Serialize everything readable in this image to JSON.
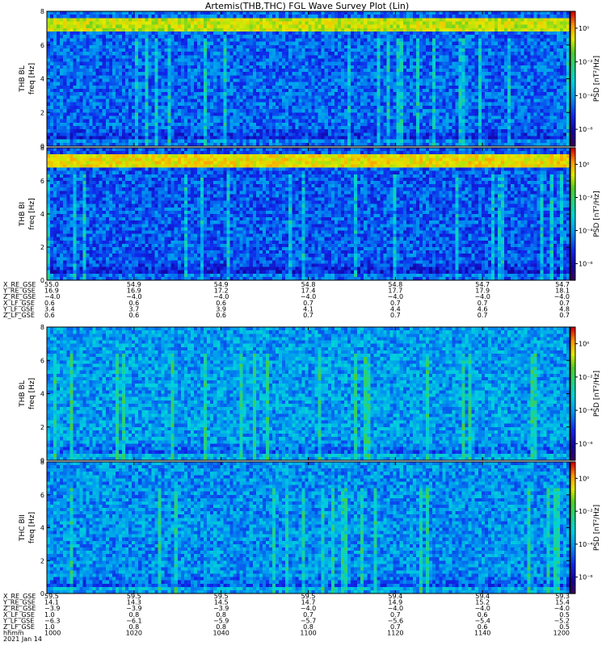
{
  "title": "Artemis(THB,THC) FGL Wave Survey Plot (Lin)",
  "colors": {
    "background": "#ffffff",
    "frame": "#000000"
  },
  "chart_data": {
    "type": "heatmap",
    "title": "Artemis(THB,THC) FGL Wave Survey Plot (Lin)",
    "xlabel": "hhmm",
    "date_label": "2021 Jan 14",
    "x_ticks": [
      "1000",
      "1020",
      "1040",
      "1100",
      "1120",
      "1140",
      "1200"
    ],
    "colormap": "rainbow (purple-blue-cyan-green-yellow-red)",
    "panels": [
      {
        "id": "thb-bl",
        "ylabel_top": "THB BL",
        "ylabel_bottom": "freq [Hz]",
        "yticks": [
          "0",
          "2",
          "4",
          "6",
          "8"
        ],
        "ylim": [
          0,
          8
        ],
        "zlabel": "PSD [nT²/Hz]",
        "zticks": [
          "10⁰",
          "10⁻²",
          "10⁻⁴",
          "10⁻⁶"
        ],
        "zlim_exp": [
          -7,
          1
        ],
        "group": "THB",
        "features": {
          "line_band_hz": [
            6.9,
            7.6
          ],
          "line_level": 0.78,
          "base_level": 0.3
        }
      },
      {
        "id": "thb-bi",
        "ylabel_top": "THB BI",
        "ylabel_bottom": "freq [Hz]",
        "yticks": [
          "0",
          "2",
          "4",
          "6",
          "8"
        ],
        "ylim": [
          0,
          8
        ],
        "zlabel": "PSD [nT²/Hz]",
        "zticks": [
          "10⁰",
          "10⁻²",
          "10⁻⁴",
          "10⁻⁶"
        ],
        "zlim_exp": [
          -7,
          1
        ],
        "group": "THB",
        "features": {
          "line_band_hz": [
            6.9,
            7.6
          ],
          "line_level": 0.82,
          "base_level": 0.28
        }
      },
      {
        "id": "thb-bl-2",
        "ylabel_top": "THB BL",
        "ylabel_bottom": "freq [Hz]",
        "yticks": [
          "0",
          "2",
          "4",
          "6",
          "8"
        ],
        "ylim": [
          0,
          8
        ],
        "zlabel": "PSD [nT²/Hz]",
        "zticks": [
          "10⁰",
          "10⁻²",
          "10⁻⁴",
          "10⁻⁶"
        ],
        "zlim_exp": [
          -7,
          1
        ],
        "group": "THC",
        "features": {
          "line_band_hz": null,
          "line_level": 0,
          "base_level": 0.38
        }
      },
      {
        "id": "thc-bii",
        "ylabel_top": "THC BII",
        "ylabel_bottom": "freq [Hz]",
        "yticks": [
          "0",
          "2",
          "4",
          "6",
          "8"
        ],
        "ylim": [
          0,
          8
        ],
        "zlabel": "PSD [nT²/Hz]",
        "zticks": [
          "10⁰",
          "10⁻²",
          "10⁻⁴",
          "10⁻⁶"
        ],
        "zlim_exp": [
          -7,
          1
        ],
        "group": "THC",
        "features": {
          "line_band_hz": null,
          "line_level": 0,
          "base_level": 0.36
        }
      }
    ],
    "ephemeris": [
      {
        "group": "THB",
        "rows": [
          {
            "label": "X_RE_GSE",
            "values": [
              "55.0",
              "54.9",
              "54.9",
              "54.8",
              "54.8",
              "54.7",
              "54.7"
            ]
          },
          {
            "label": "Y_RE_GSE",
            "values": [
              "16.9",
              "16.9",
              "17.2",
              "17.4",
              "17.7",
              "17.9",
              "18.1"
            ]
          },
          {
            "label": "Z_RE_GSE",
            "values": [
              "−4.0",
              "−4.0",
              "−4.0",
              "−4.0",
              "−4.0",
              "−4.0",
              "−4.0"
            ]
          },
          {
            "label": "X_LF_GSE",
            "values": [
              "0.6",
              "0.6",
              "0.6",
              "0.7",
              "0.7",
              "0.7",
              "0.7"
            ]
          },
          {
            "label": "Y_LF_GSE",
            "values": [
              "3.4",
              "3.7",
              "3.9",
              "4.1",
              "4.4",
              "4.6",
              "4.8"
            ]
          },
          {
            "label": "Z_LF_GSE",
            "values": [
              "0.6",
              "0.6",
              "0.6",
              "0.7",
              "0.7",
              "0.7",
              "0.7"
            ]
          }
        ]
      },
      {
        "group": "THC",
        "rows": [
          {
            "label": "X_RE_GSE",
            "values": [
              "59.5",
              "59.5",
              "59.5",
              "59.5",
              "59.4",
              "59.4",
              "59.3"
            ]
          },
          {
            "label": "Y_RE_GSE",
            "values": [
              "14.1",
              "14.3",
              "14.5",
              "14.7",
              "14.9",
              "15.2",
              "15.4"
            ]
          },
          {
            "label": "Z_RE_GSE",
            "values": [
              "−3.9",
              "−3.9",
              "−3.9",
              "−4.0",
              "−4.0",
              "−4.0",
              "−4.0"
            ]
          },
          {
            "label": "X_LF_GSE",
            "values": [
              "1.0",
              "0.8",
              "0.8",
              "0.7",
              "0.7",
              "0.6",
              "0.5"
            ]
          },
          {
            "label": "Y_LF_GSE",
            "values": [
              "−6.3",
              "−6.1",
              "−5.9",
              "−5.7",
              "−5.6",
              "−5.4",
              "−5.2"
            ]
          },
          {
            "label": "Z_LF_GSE",
            "values": [
              "1.0",
              "0.8",
              "0.8",
              "0.8",
              "0.7",
              "0.6",
              "0.5"
            ]
          }
        ]
      }
    ]
  }
}
